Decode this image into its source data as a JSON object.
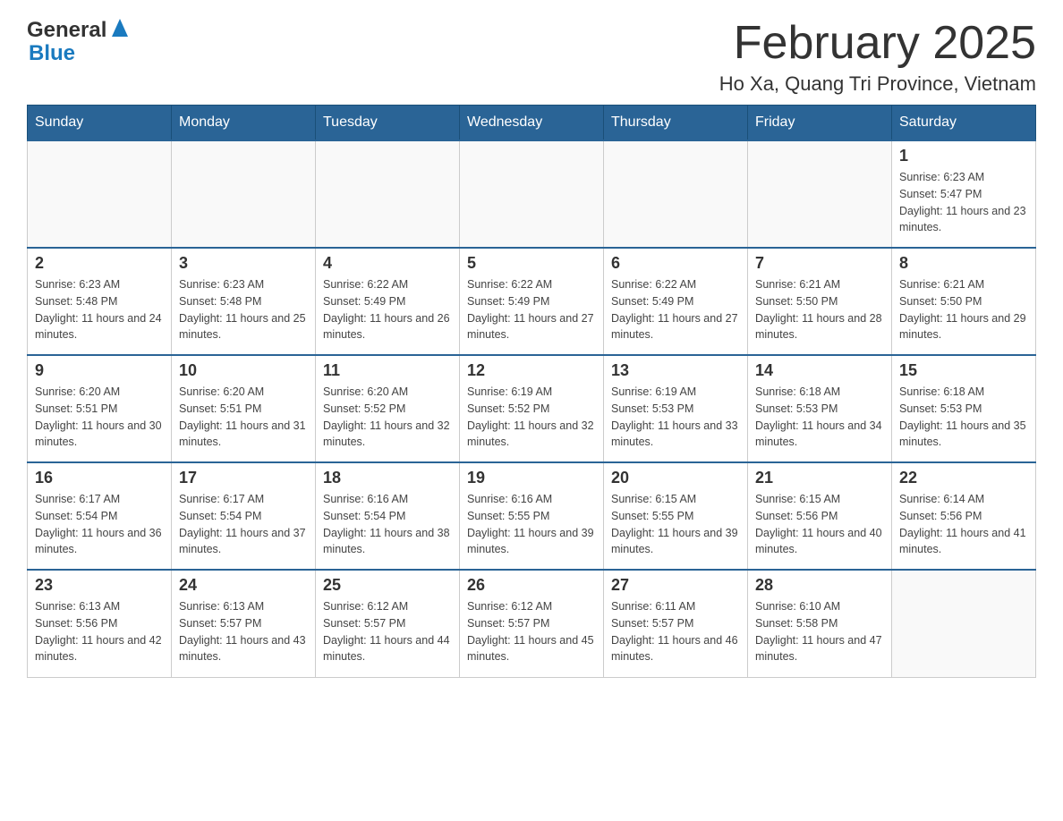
{
  "header": {
    "logo_general": "General",
    "logo_blue": "Blue",
    "calendar_title": "February 2025",
    "location": "Ho Xa, Quang Tri Province, Vietnam"
  },
  "days_of_week": [
    "Sunday",
    "Monday",
    "Tuesday",
    "Wednesday",
    "Thursday",
    "Friday",
    "Saturday"
  ],
  "weeks": [
    {
      "days": [
        {
          "number": "",
          "info": ""
        },
        {
          "number": "",
          "info": ""
        },
        {
          "number": "",
          "info": ""
        },
        {
          "number": "",
          "info": ""
        },
        {
          "number": "",
          "info": ""
        },
        {
          "number": "",
          "info": ""
        },
        {
          "number": "1",
          "info": "Sunrise: 6:23 AM\nSunset: 5:47 PM\nDaylight: 11 hours and 23 minutes."
        }
      ]
    },
    {
      "days": [
        {
          "number": "2",
          "info": "Sunrise: 6:23 AM\nSunset: 5:48 PM\nDaylight: 11 hours and 24 minutes."
        },
        {
          "number": "3",
          "info": "Sunrise: 6:23 AM\nSunset: 5:48 PM\nDaylight: 11 hours and 25 minutes."
        },
        {
          "number": "4",
          "info": "Sunrise: 6:22 AM\nSunset: 5:49 PM\nDaylight: 11 hours and 26 minutes."
        },
        {
          "number": "5",
          "info": "Sunrise: 6:22 AM\nSunset: 5:49 PM\nDaylight: 11 hours and 27 minutes."
        },
        {
          "number": "6",
          "info": "Sunrise: 6:22 AM\nSunset: 5:49 PM\nDaylight: 11 hours and 27 minutes."
        },
        {
          "number": "7",
          "info": "Sunrise: 6:21 AM\nSunset: 5:50 PM\nDaylight: 11 hours and 28 minutes."
        },
        {
          "number": "8",
          "info": "Sunrise: 6:21 AM\nSunset: 5:50 PM\nDaylight: 11 hours and 29 minutes."
        }
      ]
    },
    {
      "days": [
        {
          "number": "9",
          "info": "Sunrise: 6:20 AM\nSunset: 5:51 PM\nDaylight: 11 hours and 30 minutes."
        },
        {
          "number": "10",
          "info": "Sunrise: 6:20 AM\nSunset: 5:51 PM\nDaylight: 11 hours and 31 minutes."
        },
        {
          "number": "11",
          "info": "Sunrise: 6:20 AM\nSunset: 5:52 PM\nDaylight: 11 hours and 32 minutes."
        },
        {
          "number": "12",
          "info": "Sunrise: 6:19 AM\nSunset: 5:52 PM\nDaylight: 11 hours and 32 minutes."
        },
        {
          "number": "13",
          "info": "Sunrise: 6:19 AM\nSunset: 5:53 PM\nDaylight: 11 hours and 33 minutes."
        },
        {
          "number": "14",
          "info": "Sunrise: 6:18 AM\nSunset: 5:53 PM\nDaylight: 11 hours and 34 minutes."
        },
        {
          "number": "15",
          "info": "Sunrise: 6:18 AM\nSunset: 5:53 PM\nDaylight: 11 hours and 35 minutes."
        }
      ]
    },
    {
      "days": [
        {
          "number": "16",
          "info": "Sunrise: 6:17 AM\nSunset: 5:54 PM\nDaylight: 11 hours and 36 minutes."
        },
        {
          "number": "17",
          "info": "Sunrise: 6:17 AM\nSunset: 5:54 PM\nDaylight: 11 hours and 37 minutes."
        },
        {
          "number": "18",
          "info": "Sunrise: 6:16 AM\nSunset: 5:54 PM\nDaylight: 11 hours and 38 minutes."
        },
        {
          "number": "19",
          "info": "Sunrise: 6:16 AM\nSunset: 5:55 PM\nDaylight: 11 hours and 39 minutes."
        },
        {
          "number": "20",
          "info": "Sunrise: 6:15 AM\nSunset: 5:55 PM\nDaylight: 11 hours and 39 minutes."
        },
        {
          "number": "21",
          "info": "Sunrise: 6:15 AM\nSunset: 5:56 PM\nDaylight: 11 hours and 40 minutes."
        },
        {
          "number": "22",
          "info": "Sunrise: 6:14 AM\nSunset: 5:56 PM\nDaylight: 11 hours and 41 minutes."
        }
      ]
    },
    {
      "days": [
        {
          "number": "23",
          "info": "Sunrise: 6:13 AM\nSunset: 5:56 PM\nDaylight: 11 hours and 42 minutes."
        },
        {
          "number": "24",
          "info": "Sunrise: 6:13 AM\nSunset: 5:57 PM\nDaylight: 11 hours and 43 minutes."
        },
        {
          "number": "25",
          "info": "Sunrise: 6:12 AM\nSunset: 5:57 PM\nDaylight: 11 hours and 44 minutes."
        },
        {
          "number": "26",
          "info": "Sunrise: 6:12 AM\nSunset: 5:57 PM\nDaylight: 11 hours and 45 minutes."
        },
        {
          "number": "27",
          "info": "Sunrise: 6:11 AM\nSunset: 5:57 PM\nDaylight: 11 hours and 46 minutes."
        },
        {
          "number": "28",
          "info": "Sunrise: 6:10 AM\nSunset: 5:58 PM\nDaylight: 11 hours and 47 minutes."
        },
        {
          "number": "",
          "info": ""
        }
      ]
    }
  ]
}
